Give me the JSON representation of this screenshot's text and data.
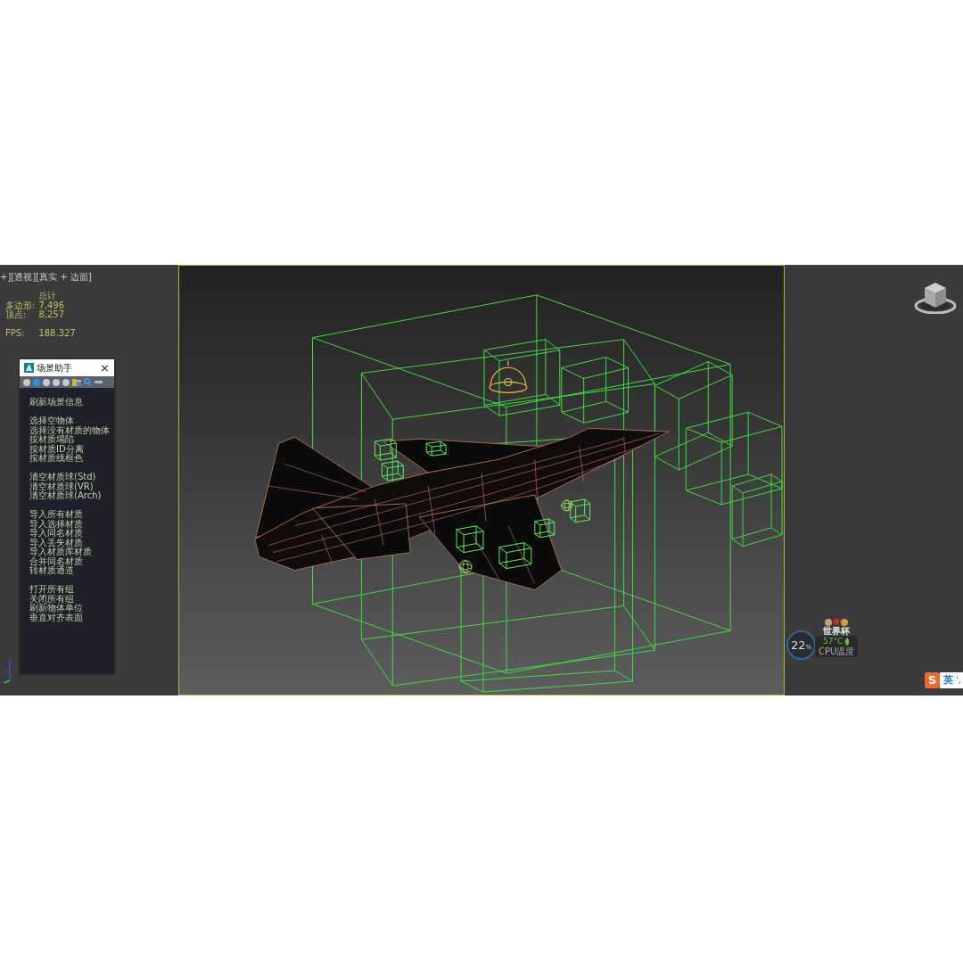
{
  "left_viewport": {
    "label": "+][透视][真实 + 边面]",
    "stats": {
      "header": "总计",
      "rows": [
        {
          "label": "多边形:",
          "value": "7,496"
        },
        {
          "label": "顶点:",
          "value": "8,257"
        }
      ],
      "fps": {
        "label": "FPS:",
        "value": "188.327"
      }
    }
  },
  "dialog": {
    "title": "场景助手",
    "close": "×",
    "toolbar": [
      {
        "kind": "dot",
        "selected": false
      },
      {
        "kind": "dot",
        "selected": true
      },
      {
        "kind": "dot",
        "selected": false
      },
      {
        "kind": "dot",
        "selected": false
      },
      {
        "kind": "dot",
        "selected": false
      },
      {
        "kind": "group",
        "selected": false
      },
      {
        "kind": "search",
        "selected": false
      },
      {
        "kind": "minimize",
        "selected": false
      }
    ],
    "groups": [
      {
        "items": [
          "刷新场景信息"
        ]
      },
      {
        "items": [
          "选择空物体",
          "选择没有材质的物体",
          "按材质塌陷",
          "按材质ID分离",
          "按材质线框色"
        ]
      },
      {
        "items": [
          "清空材质球(Std)",
          "清空材质球(VR)",
          "清空材质球(Arch)"
        ]
      },
      {
        "items": [
          "导入所有材质",
          "导入选择材质",
          "导入同名材质",
          "导入丢失材质",
          "导入材质库材质",
          "合并同名材质",
          "转材质通道"
        ]
      },
      {
        "items": [
          "打开所有组",
          "关闭所有组",
          "刷新物体单位",
          "垂直对齐表面"
        ]
      }
    ]
  },
  "cpu_widget": {
    "badge": "世界杯",
    "usage": "22",
    "unit": "%",
    "temperature": "57°C",
    "label": "CPU温度"
  },
  "ime": {
    "logo": "S",
    "mode": "英",
    "punctuation": "',"
  }
}
